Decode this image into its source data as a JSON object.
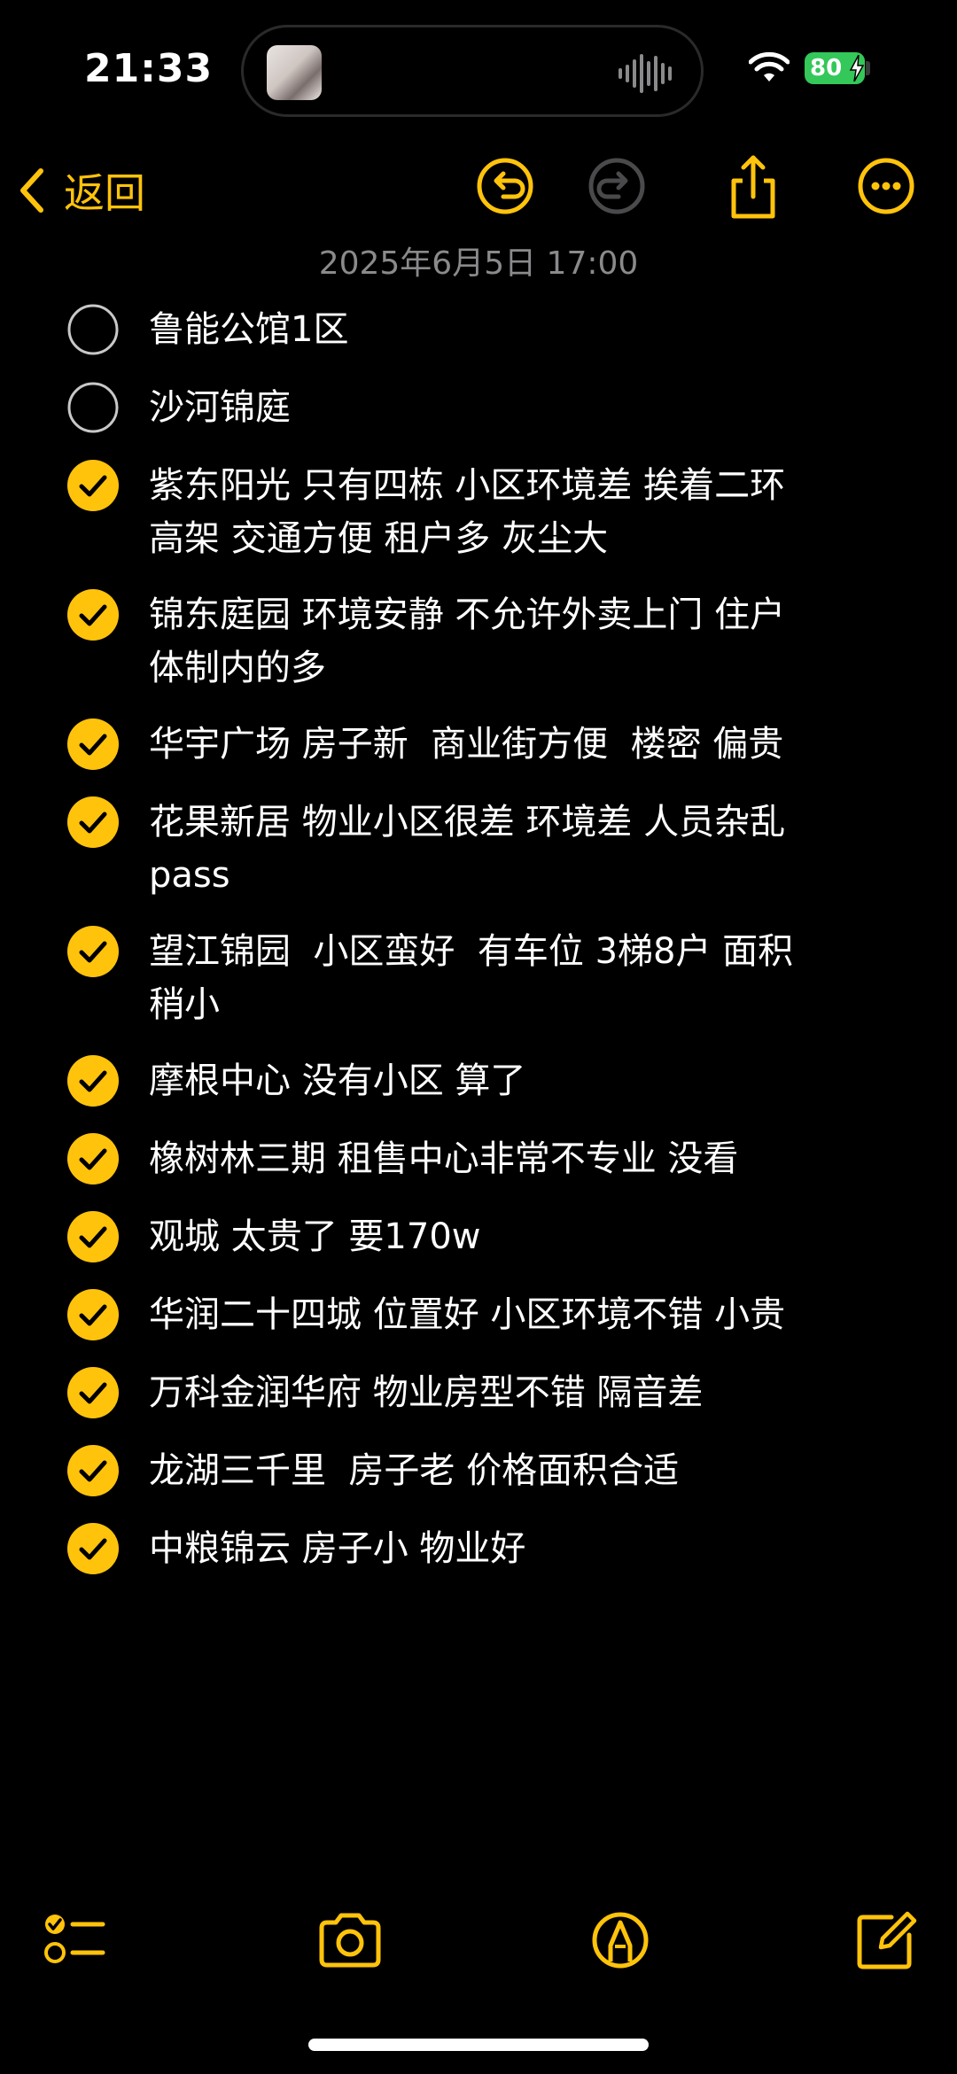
{
  "status_bar": {
    "time": "21:33",
    "battery": "80"
  },
  "nav": {
    "back_label": "返回"
  },
  "note": {
    "date": "2025年6月5日 17:00",
    "items": [
      {
        "text": "鲁能公馆1区",
        "checked": false
      },
      {
        "text": "沙河锦庭",
        "checked": false
      },
      {
        "text": "紫东阳光 只有四栋 小区环境差 挨着二环\n高架 交通方便 租户多 灰尘大",
        "checked": true
      },
      {
        "text": "锦东庭园 环境安静 不允许外卖上门 住户\n体制内的多",
        "checked": true
      },
      {
        "text": "华宇广场 房子新  商业街方便  楼密 偏贵",
        "checked": true
      },
      {
        "text": "花果新居 物业小区很差 环境差 人员杂乱\npass",
        "checked": true
      },
      {
        "text": "望江锦园  小区蛮好  有车位 3梯8户 面积\n稍小",
        "checked": true
      },
      {
        "text": "摩根中心 没有小区 算了",
        "checked": true
      },
      {
        "text": "橡树林三期 租售中心非常不专业 没看",
        "checked": true
      },
      {
        "text": "观城 太贵了 要170w",
        "checked": true
      },
      {
        "text": "华润二十四城 位置好 小区环境不错 小贵",
        "checked": true
      },
      {
        "text": "万科金润华府 物业房型不错 隔音差",
        "checked": true
      },
      {
        "text": "龙湖三千里  房子老 价格面积合适",
        "checked": true
      },
      {
        "text": "中粮锦云 房子小 物业好",
        "checked": true
      }
    ]
  },
  "colors": {
    "accent": "#ffc30b",
    "background": "#000000",
    "date": "#8a8a8d",
    "battery": "#34c759"
  },
  "icons": {
    "back": "chevron-left-icon",
    "undo": "undo-icon",
    "redo": "redo-icon",
    "share": "share-icon",
    "more": "more-icon",
    "checklist": "checklist-icon",
    "camera": "camera-icon",
    "markup": "markup-pen-icon",
    "compose": "compose-icon"
  }
}
